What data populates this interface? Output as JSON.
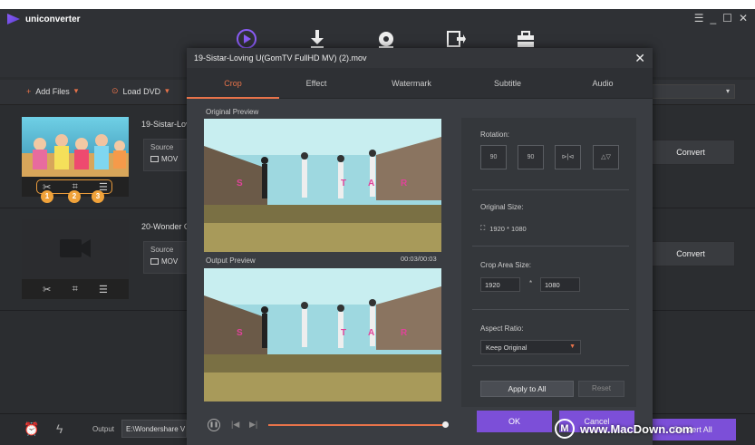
{
  "app": {
    "name": "uniconverter",
    "window_controls": [
      "☰",
      "_",
      "☐",
      "✕"
    ]
  },
  "toolbar": {
    "add_files": "Add Files",
    "load_dvd": "Load DVD"
  },
  "files": [
    {
      "name": "19-Sistar-Lov",
      "source_label": "Source",
      "format": "MOV",
      "convert_label": "Convert"
    },
    {
      "name": "20-Wonder G",
      "source_label": "Source",
      "format": "MOV",
      "convert_label": "Convert"
    }
  ],
  "annotations": [
    "1",
    "2",
    "3"
  ],
  "bottom": {
    "output_label": "Output",
    "output_path": "E:\\Wondershare V",
    "convert_all": "Convert All"
  },
  "dialog": {
    "title": "19-Sistar-Loving U(GomTV FullHD MV) (2).mov",
    "tabs": [
      "Crop",
      "Effect",
      "Watermark",
      "Subtitle",
      "Audio"
    ],
    "active_tab": 0,
    "original_preview_label": "Original Preview",
    "output_preview_label": "Output Preview",
    "timecode": "00:03/00:03",
    "preview_letters": [
      "S",
      "T",
      "A",
      "R"
    ],
    "rotation_label": "Rotation:",
    "rotation_buttons": [
      "90",
      "90",
      "⊳|⊲",
      "△▽"
    ],
    "original_size_label": "Original Size:",
    "original_size": "1920 * 1080",
    "crop_area_label": "Crop Area Size:",
    "crop_width": "1920",
    "crop_separator": "*",
    "crop_height": "1080",
    "aspect_ratio_label": "Aspect Ratio:",
    "aspect_ratio_value": "Keep Original",
    "apply_all": "Apply to All",
    "reset": "Reset",
    "ok": "OK",
    "cancel": "Cancel"
  },
  "watermark_text": "www.MacDown.com",
  "watermark_logo": "M",
  "colors": {
    "accent_orange": "#e8734a",
    "accent_purple": "#7c4fd8",
    "badge": "#f0a23a"
  }
}
